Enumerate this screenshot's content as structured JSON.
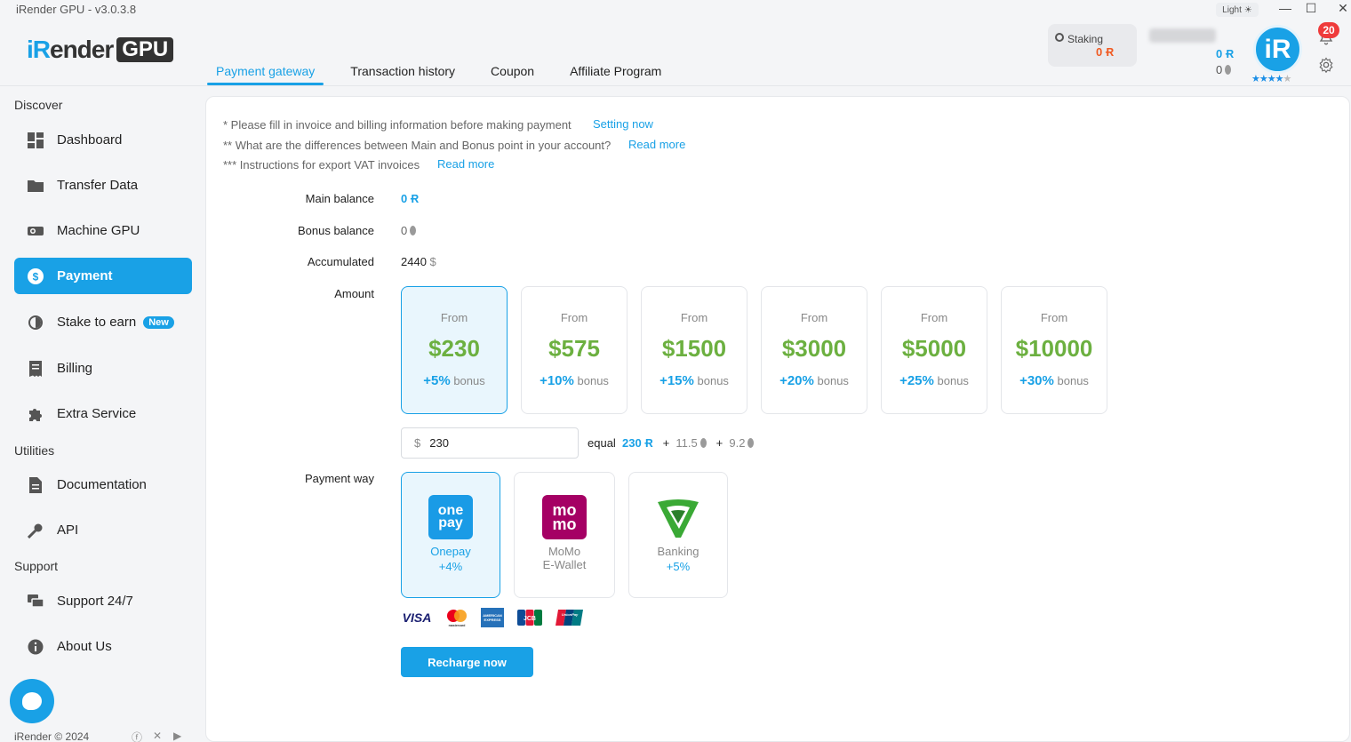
{
  "window": {
    "title": "iRender GPU - v3.0.3.8",
    "theme_label": "Light"
  },
  "logo": {
    "ir": "iR",
    "ender": "ender",
    "gpu": "GPU"
  },
  "tabs": [
    {
      "label": "Payment gateway",
      "active": true
    },
    {
      "label": "Transaction history",
      "active": false
    },
    {
      "label": "Coupon",
      "active": false
    },
    {
      "label": "Affiliate Program",
      "active": false
    }
  ],
  "header": {
    "staking_label": "Staking",
    "staking_value": "0 Ɍ",
    "main_points": "0 Ɍ",
    "bonus_points": "0",
    "notifications": "20",
    "avatar_text": "iR",
    "rating": 4
  },
  "sidebar": {
    "discover_label": "Discover",
    "utilities_label": "Utilities",
    "support_label": "Support",
    "items": [
      {
        "label": "Dashboard",
        "icon": "dashboard-icon"
      },
      {
        "label": "Transfer Data",
        "icon": "folder-icon"
      },
      {
        "label": "Machine GPU",
        "icon": "gpu-icon"
      },
      {
        "label": "Payment",
        "icon": "dollar-icon",
        "active": true
      },
      {
        "label": "Stake to earn",
        "icon": "stake-icon",
        "badge": "New"
      },
      {
        "label": "Billing",
        "icon": "billing-icon"
      },
      {
        "label": "Extra Service",
        "icon": "puzzle-icon"
      },
      {
        "label": "Documentation",
        "icon": "document-icon"
      },
      {
        "label": "API",
        "icon": "key-icon"
      },
      {
        "label": "Support 24/7",
        "icon": "chat-icon"
      },
      {
        "label": "About Us",
        "icon": "info-icon"
      }
    ],
    "copyright": "iRender © 2024"
  },
  "notes": [
    {
      "text": "* Please fill in invoice and billing information before making payment",
      "link": "Setting now"
    },
    {
      "text": "** What are the differences between Main and Bonus point in your account?",
      "link": "Read more"
    },
    {
      "text": "*** Instructions for export VAT invoices",
      "link": "Read more"
    }
  ],
  "balances": {
    "main_label": "Main balance",
    "main_value": "0",
    "bonus_label": "Bonus balance",
    "bonus_value": "0",
    "accumulated_label": "Accumulated",
    "accumulated_value": "2440",
    "accumulated_unit": "$"
  },
  "amount": {
    "label": "Amount",
    "from_label": "From",
    "bonus_label": "bonus",
    "options": [
      {
        "value": "$230",
        "bonus": "+5%",
        "active": true
      },
      {
        "value": "$575",
        "bonus": "+10%"
      },
      {
        "value": "$1500",
        "bonus": "+15%"
      },
      {
        "value": "$3000",
        "bonus": "+20%"
      },
      {
        "value": "$5000",
        "bonus": "+25%"
      },
      {
        "value": "$10000",
        "bonus": "+30%"
      }
    ],
    "input_prefix": "$",
    "input_value": "230",
    "equal_label": "equal",
    "equal_main": "230",
    "equal_bonus1": "11.5",
    "equal_bonus2": "9.2"
  },
  "payment_way": {
    "label": "Payment way",
    "methods": [
      {
        "name": "Onepay",
        "fee": "+4%",
        "logo_text": "one pay",
        "active": true,
        "color": "#1a9be6"
      },
      {
        "name": "MoMo\nE-Wallet",
        "fee": "",
        "logo_text": "mo mo",
        "color": "#a50064"
      },
      {
        "name": "Banking",
        "fee": "+5%",
        "logo_text": "",
        "color": "#3aa935"
      }
    ],
    "cards": [
      "VISA",
      "mastercard",
      "AMERICAN EXPRESS",
      "JCB",
      "UnionPay"
    ]
  },
  "recharge_label": "Recharge now",
  "colors": {
    "accent": "#19a1e6",
    "amount_green": "#6cb040",
    "staking_orange": "#f05a22"
  }
}
